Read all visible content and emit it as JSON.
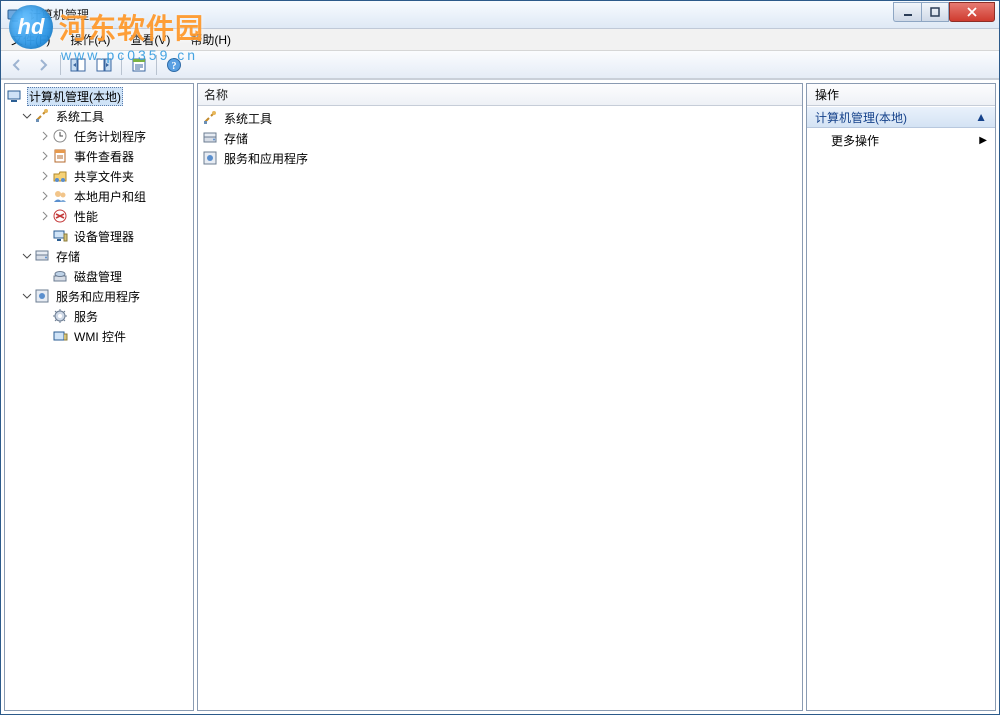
{
  "window": {
    "title": "计算机管理"
  },
  "watermark": {
    "brand": "河东软件园",
    "domain": "www.pc0359.cn",
    "logo_text": "hd"
  },
  "menu": {
    "file": "文件(F)",
    "action": "操作(A)",
    "view": "查看(V)",
    "help": "帮助(H)"
  },
  "tree": {
    "root": "计算机管理(本地)",
    "groups": [
      {
        "label": "系统工具",
        "icon": "tools",
        "children": [
          {
            "label": "任务计划程序",
            "icon": "clock",
            "expandable": true
          },
          {
            "label": "事件查看器",
            "icon": "event",
            "expandable": true
          },
          {
            "label": "共享文件夹",
            "icon": "share",
            "expandable": true
          },
          {
            "label": "本地用户和组",
            "icon": "users",
            "expandable": true
          },
          {
            "label": "性能",
            "icon": "perf",
            "expandable": true
          },
          {
            "label": "设备管理器",
            "icon": "device",
            "expandable": false
          }
        ]
      },
      {
        "label": "存储",
        "icon": "storage",
        "children": [
          {
            "label": "磁盘管理",
            "icon": "disk",
            "expandable": false
          }
        ]
      },
      {
        "label": "服务和应用程序",
        "icon": "services-app",
        "children": [
          {
            "label": "服务",
            "icon": "gear",
            "expandable": false
          },
          {
            "label": "WMI 控件",
            "icon": "wmi",
            "expandable": false
          }
        ]
      }
    ]
  },
  "center": {
    "column_header": "名称",
    "items": [
      {
        "label": "系统工具",
        "icon": "tools"
      },
      {
        "label": "存储",
        "icon": "storage"
      },
      {
        "label": "服务和应用程序",
        "icon": "services-app"
      }
    ]
  },
  "actions": {
    "header": "操作",
    "section_title": "计算机管理(本地)",
    "more": "更多操作"
  }
}
